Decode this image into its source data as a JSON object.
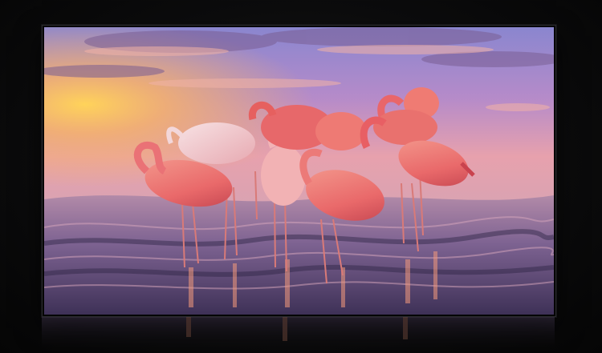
{
  "scene": {
    "subject-icon": "flamingo-flock-icon",
    "sky_colors": [
      "#8c8ad0",
      "#b58ac8",
      "#e79aa6",
      "#f5c56f"
    ],
    "water_colors": [
      "#6f5a86",
      "#b889a6",
      "#3f3358",
      "#f0a08a"
    ],
    "flamingo_color": "#ec6f6a",
    "bezel_color": "#050505",
    "backdrop_color": "#0c0c0d"
  }
}
